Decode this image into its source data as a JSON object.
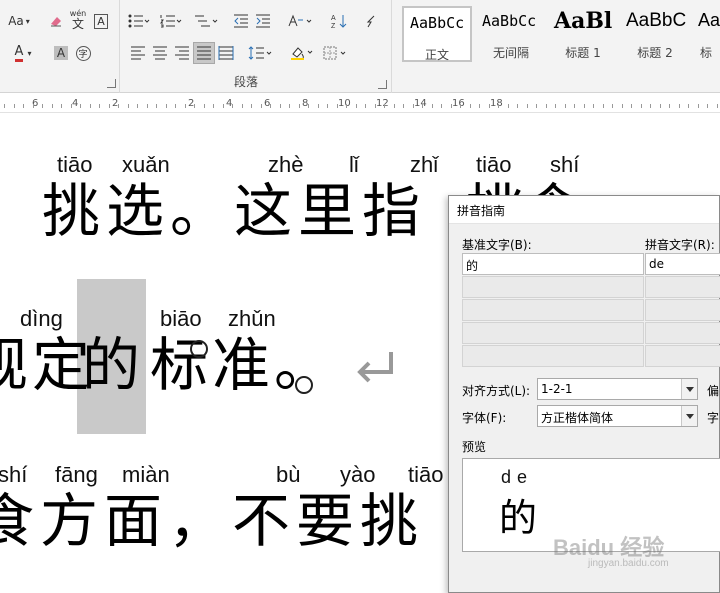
{
  "ribbon": {
    "font_size_label": "Aa",
    "pinyin_guide_btn": "wén",
    "pinyin_guide_char": "文",
    "boxed_char": "A",
    "char_shading": "A",
    "font_color": "A",
    "enclosed_char": "字",
    "change_case": "Aa",
    "paragraph_group_label": "段落",
    "styles": [
      {
        "preview": "AaBbCc",
        "name": "正文"
      },
      {
        "preview": "AaBbCc",
        "name": "无间隔"
      },
      {
        "preview": "AaBl",
        "name": "标题 1"
      },
      {
        "preview": "AaBbC",
        "name": "标题 2"
      },
      {
        "preview": "Aa",
        "name": "标"
      }
    ]
  },
  "ruler": {
    "marks": [
      "6",
      "4",
      "2",
      "2",
      "4",
      "6",
      "8",
      "10",
      "12",
      "14",
      "16",
      "18"
    ]
  },
  "document": {
    "line1": {
      "pinyin": [
        "tiāo",
        "xuǎn",
        "zhè",
        "lǐ",
        "zhǐ",
        "tiāo",
        "shí"
      ],
      "chars": "挑选。这里指",
      "trailing": "挑食"
    },
    "line2": {
      "pinyin": [
        "dìng",
        "biāo",
        "zhǔn"
      ],
      "chars_before": "规定",
      "selected_char": "的",
      "chars_after": "标准。"
    },
    "line3": {
      "pinyin": [
        "shí",
        "fāng",
        "miàn",
        "bù",
        "yào",
        "tiāo"
      ],
      "chars": "食方面，不要挑"
    }
  },
  "dialog": {
    "title": "拼音指南",
    "base_text_label": "基准文字(B):",
    "ruby_text_label": "拼音文字(R):",
    "base_text_value": "的",
    "ruby_text_value": "de",
    "alignment_label": "对齐方式(L):",
    "alignment_value": "1-2-1",
    "offset_label_partial": "偏",
    "font_label": "字体(F):",
    "font_value": "方正楷体简体",
    "size_label_partial": "字",
    "preview_label": "预览",
    "preview_ruby": "de",
    "preview_base": "的"
  },
  "watermark": {
    "brand": "Baidu 经验",
    "url": "jingyan.baidu.com"
  }
}
